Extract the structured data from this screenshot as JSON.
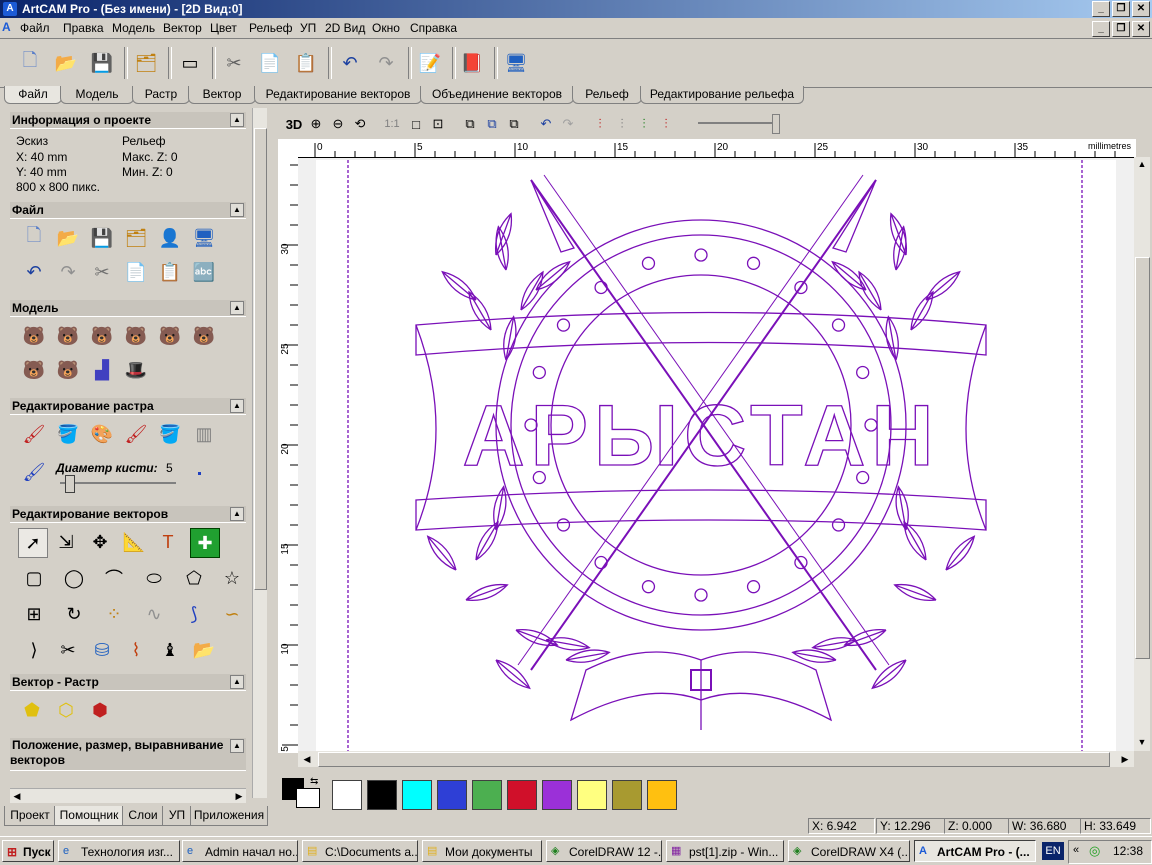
{
  "window": {
    "title": "ArtCAM Pro - (Без имени) - [2D Вид:0]"
  },
  "menu": [
    "Файл",
    "Правка",
    "Модель",
    "Вектор",
    "Цвет",
    "Рельеф",
    "УП",
    "2D Вид",
    "Окно",
    "Справка"
  ],
  "top_tabs": [
    "Файл",
    "Модель",
    "Растр",
    "Вектор",
    "Редактирование векторов",
    "Объединение векторов",
    "Рельеф",
    "Редактирование рельефа"
  ],
  "panel": {
    "project_info": {
      "title": "Информация о проекте",
      "sketch_label": "Эскиз",
      "relief_label": "Рельеф",
      "x": "X: 40 mm",
      "y": "Y: 40 mm",
      "pixels": "800 x 800 пикс.",
      "max_z": "Макс. Z: 0",
      "min_z": "Мин. Z: 0"
    },
    "sections": {
      "file": "Файл",
      "model": "Модель",
      "raster_edit": "Редактирование растра",
      "vector_edit": "Редактирование векторов",
      "vector_raster": "Вектор - Растр",
      "position": "Положение, размер, выравнивание векторов"
    },
    "brush_label": "Диаметр кисти:",
    "brush_value": "5",
    "brush_value_fraction": 0.05
  },
  "bottom_tabs": [
    "Проект",
    "Помощник",
    "Слои",
    "УП",
    "Приложения"
  ],
  "view_toolbar": {
    "mode_3d": "3D",
    "ratio": "1:1"
  },
  "ruler": {
    "unit": "millimetres",
    "h_ticks": [
      "0",
      "5",
      "10",
      "15",
      "20",
      "25",
      "30",
      "35"
    ],
    "v_ticks": [
      "30",
      "25",
      "20",
      "15",
      "10",
      "5"
    ]
  },
  "drawing": {
    "text": "АРЫСТАН",
    "color": "#7a10b8"
  },
  "palette": [
    "#ffffff",
    "#000000",
    "#00ffff",
    "#2e3fd6",
    "#4caf50",
    "#d0102a",
    "#9b30d8",
    "#ffff80",
    "#a89a30",
    "#ffc010"
  ],
  "status": {
    "x": "X: 6.942",
    "y": "Y: 12.296",
    "z": "Z: 0.000",
    "w": "W: 36.680",
    "h": "H: 33.649"
  },
  "taskbar": {
    "start": "Пуск",
    "items": [
      "Технология изг...",
      "Admin начал но...",
      "C:\\Documents a...",
      "Мои документы",
      "CorelDRAW 12 -...",
      "pst[1].zip - Win...",
      "CorelDRAW X4 (...",
      "ArtCAM Pro - (..."
    ],
    "lang": "EN",
    "time": "12:38"
  }
}
